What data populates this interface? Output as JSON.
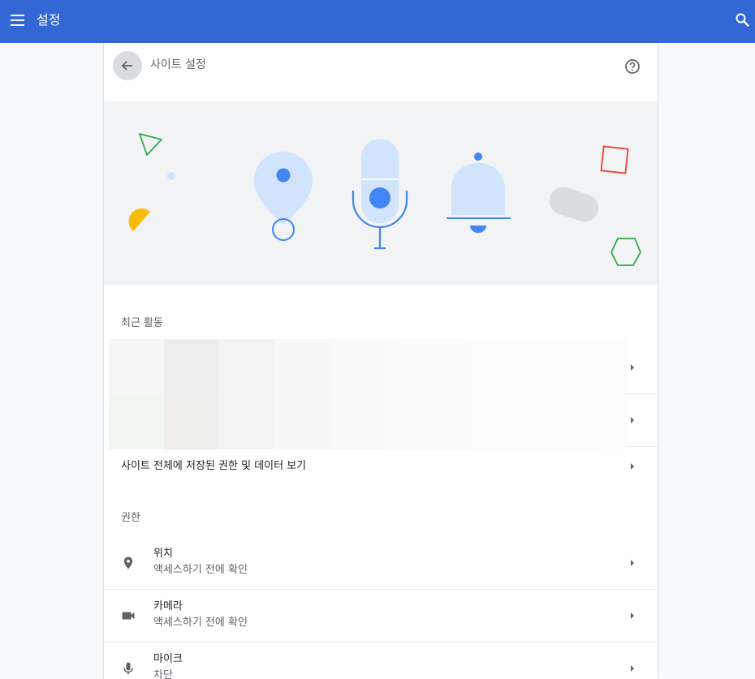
{
  "app": {
    "title": "설정"
  },
  "header": {
    "title": "사이트 설정"
  },
  "recent_activity": {
    "label": "최근 활동"
  },
  "site_data_link": {
    "label": "사이트 전체에 저장된 권한 및 데이터 보기"
  },
  "permissions": {
    "label": "권한",
    "items": [
      {
        "title": "위치",
        "subtitle": "액세스하기 전에 확인",
        "icon": "location-pin-icon"
      },
      {
        "title": "카메라",
        "subtitle": "액세스하기 전에 확인",
        "icon": "camera-icon"
      },
      {
        "title": "마이크",
        "subtitle": "차단",
        "icon": "microphone-icon"
      }
    ]
  },
  "colors": {
    "top_bar": "#3367d6",
    "accent_blue": "#4285f4",
    "light_blue": "#d2e3fc",
    "green": "#34a853",
    "yellow": "#fbbc04",
    "red": "#ea4335"
  }
}
